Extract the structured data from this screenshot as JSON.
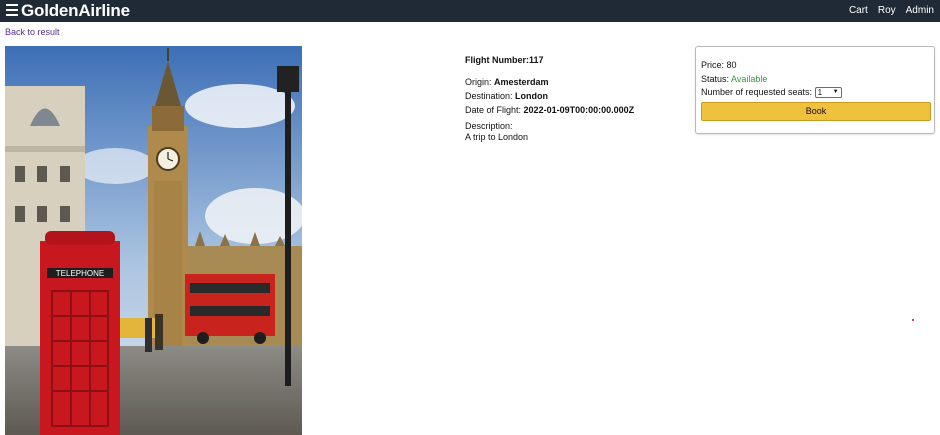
{
  "navbar": {
    "brand": "GoldenAirline",
    "links": [
      "Cart",
      "Roy",
      "Admin"
    ]
  },
  "back_link": "Back to result",
  "photo": {
    "description_icon": "london-big-ben-photo"
  },
  "flight": {
    "number_label": "Flight Number:",
    "number": "117",
    "origin_label": "Origin:",
    "origin": "Amesterdam",
    "destination_label": "Destination:",
    "destination": "London",
    "date_label": "Date of Flight:",
    "date": "2022-01-09T00:00:00.000Z",
    "description_label": "Description:",
    "description": "A trip to London"
  },
  "booking": {
    "price_label": "Price:",
    "price": "80",
    "status_label": "Status:",
    "status": "Available",
    "status_color": "#2e9c3a",
    "seats_label": "Number of requested seats:",
    "seats_selected": "1",
    "book_label": "Book",
    "book_color": "#f0c13c"
  },
  "colors": {
    "navbar": "#1f2a36",
    "link": "#5a2e8f"
  }
}
